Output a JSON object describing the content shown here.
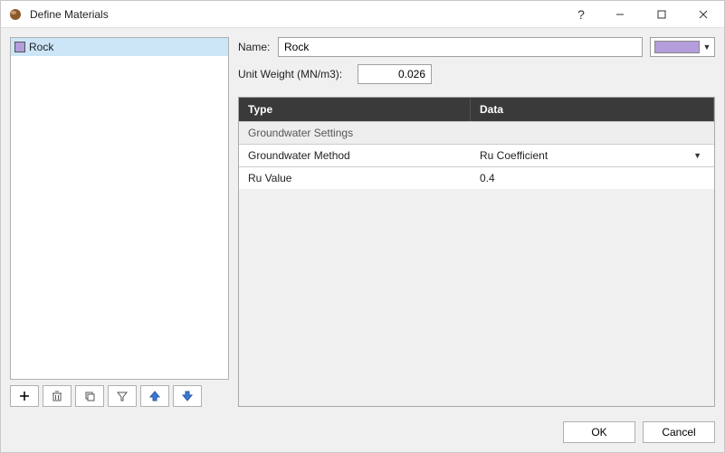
{
  "window": {
    "title": "Define Materials"
  },
  "list": {
    "items": [
      {
        "label": "Rock",
        "colorHex": "#b39ddb"
      }
    ]
  },
  "toolbar": {
    "add": "＋",
    "delete": "",
    "copy": "",
    "filter": "",
    "up": "",
    "down": ""
  },
  "form": {
    "name_label": "Name:",
    "name_value": "Rock",
    "color_value": "#b39ddb",
    "uw_label": "Unit Weight (MN/m3):",
    "uw_value": "0.026"
  },
  "table": {
    "col_type": "Type",
    "col_data": "Data",
    "sections": [
      {
        "title": "Groundwater Settings",
        "rows": [
          {
            "type": "Groundwater Method",
            "data": "Ru Coefficient",
            "dropdown": true
          },
          {
            "type": "Ru Value",
            "data": "0.4",
            "dropdown": false
          }
        ]
      }
    ]
  },
  "buttons": {
    "ok": "OK",
    "cancel": "Cancel"
  }
}
